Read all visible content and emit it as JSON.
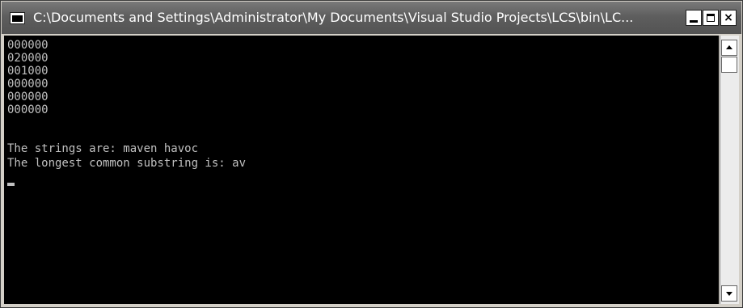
{
  "window": {
    "title": "C:\\Documents and Settings\\Administrator\\My Documents\\Visual Studio Projects\\LCS\\bin\\LC..."
  },
  "console": {
    "lines": [
      "000000",
      "020000",
      "001000",
      "000000",
      "000000",
      "000000",
      "",
      "The strings are: maven havoc",
      "The longest common substring is: av"
    ],
    "background": "#000000",
    "foreground": "#c0c0c0"
  },
  "icons": {
    "app": "console-window-icon",
    "minimize": "minimize-icon",
    "maximize": "maximize-icon",
    "close": "close-icon",
    "scroll_up": "arrow-up-icon",
    "scroll_down": "arrow-down-icon"
  },
  "title_buttons": {
    "close_glyph": "×"
  }
}
